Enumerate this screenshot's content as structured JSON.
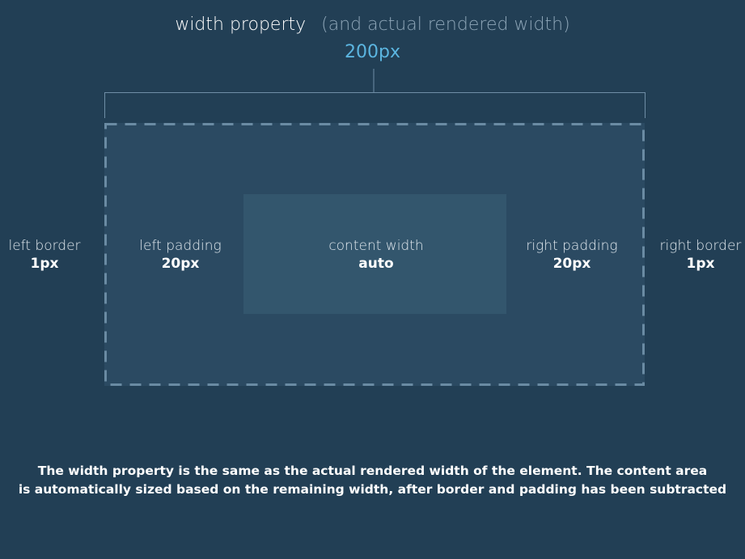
{
  "title": {
    "main": "width property",
    "sub": "(and actual rendered width)",
    "value": "200px"
  },
  "labels": {
    "left_border": {
      "name": "left border",
      "value": "1px"
    },
    "left_padding": {
      "name": "left padding",
      "value": "20px"
    },
    "content": {
      "name": "content width",
      "value": "auto"
    },
    "right_padding": {
      "name": "right padding",
      "value": "20px"
    },
    "right_border": {
      "name": "right border",
      "value": "1px"
    }
  },
  "note": {
    "line1": "The width property is the same as the actual rendered width of the element. The content area",
    "line2": "is automatically sized based on the remaining width, after border and padding has been subtracted"
  },
  "colors": {
    "background": "#223f55",
    "box": "#2b4a62",
    "content": "#33566d",
    "accent": "#5bb5e0",
    "dashed_border": "#6a8ba3"
  }
}
